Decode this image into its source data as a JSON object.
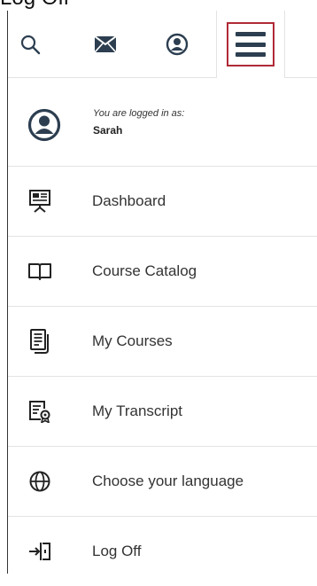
{
  "partial_header_text": "Log Off",
  "toolbar": {
    "search_icon": "search-icon",
    "mail_icon": "mail-icon",
    "profile_icon": "user-circle-icon",
    "menu_icon": "hamburger-menu-icon",
    "menu_highlight_color": "#b02a37",
    "icon_color": "#2c3e50"
  },
  "login": {
    "label": "You are logged in as:",
    "username": "Sarah"
  },
  "menu": {
    "items": [
      {
        "label": "Dashboard",
        "icon": "presentation-board-icon"
      },
      {
        "label": "Course Catalog",
        "icon": "open-book-icon"
      },
      {
        "label": "My Courses",
        "icon": "document-list-icon"
      },
      {
        "label": "My Transcript",
        "icon": "certificate-document-icon"
      },
      {
        "label": "Choose your language",
        "icon": "globe-icon"
      },
      {
        "label": "Log Off",
        "icon": "logout-icon"
      }
    ]
  }
}
